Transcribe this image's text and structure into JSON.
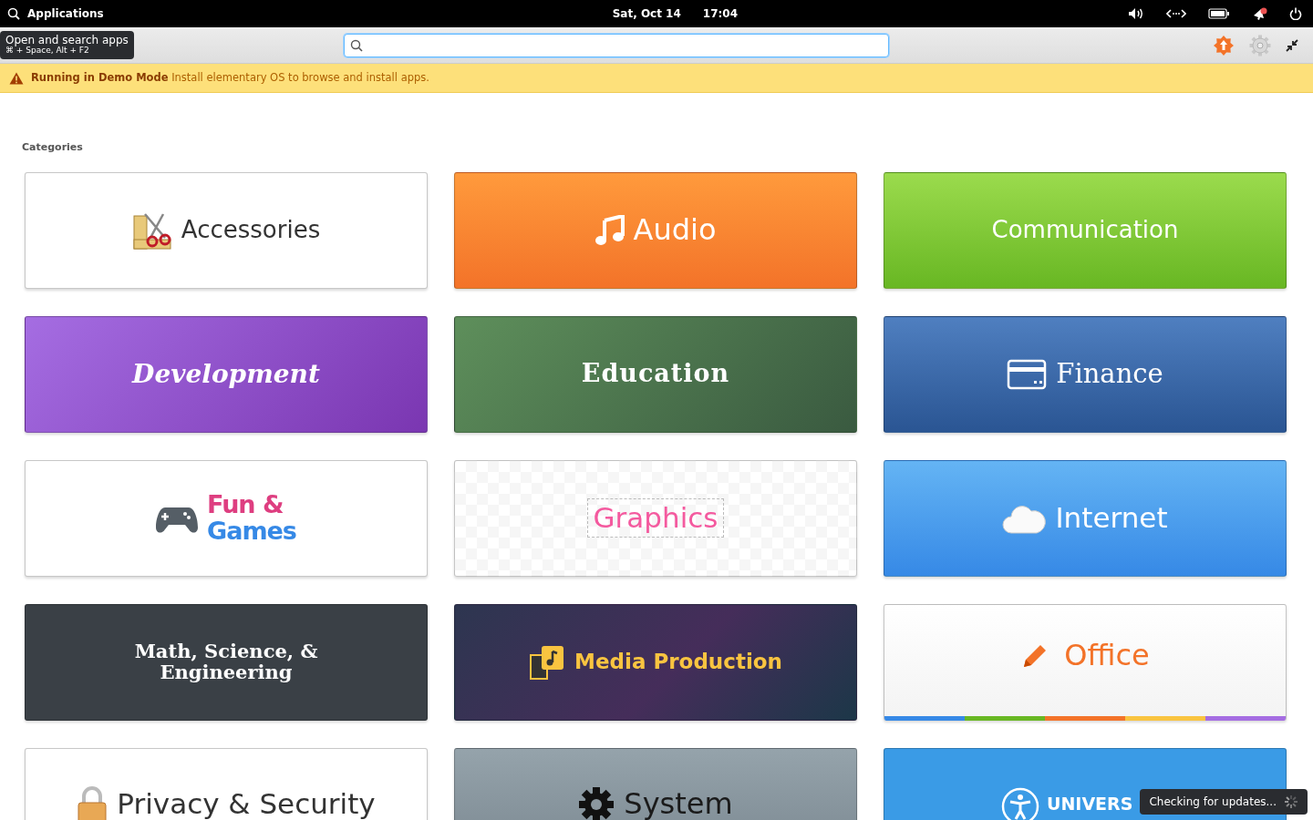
{
  "top_panel": {
    "applications": "Applications",
    "date": "Sat, Oct 14",
    "time": "17:04",
    "notification_unread": true
  },
  "tooltip": {
    "title": "Open and search apps",
    "shortcut": "⌘ + Space, Alt + F2"
  },
  "banner": {
    "text": "**Running in Demo Mode** Install elementary OS to browse and install apps."
  },
  "section_title": "Categories",
  "categories": [
    {
      "kind": "accessories",
      "lines": [
        "Accessories"
      ]
    },
    {
      "kind": "audio",
      "lines": [
        "Audio"
      ]
    },
    {
      "kind": "communication",
      "lines": [
        "Communication"
      ]
    },
    {
      "kind": "development",
      "lines": [
        "Development"
      ]
    },
    {
      "kind": "education",
      "lines": [
        "Education"
      ]
    },
    {
      "kind": "finance",
      "lines": [
        "Finance"
      ]
    },
    {
      "kind": "games",
      "lines": [
        "Fun &",
        "Games"
      ]
    },
    {
      "kind": "graphics",
      "lines": [
        "Graphics"
      ]
    },
    {
      "kind": "internet",
      "lines": [
        "Internet"
      ]
    },
    {
      "kind": "science",
      "lines": [
        "Math, Science, &",
        "Engineering"
      ]
    },
    {
      "kind": "media",
      "lines": [
        "Media Production"
      ]
    },
    {
      "kind": "office",
      "lines": [
        "Office"
      ]
    },
    {
      "kind": "privacy",
      "lines": [
        "Privacy & Security"
      ]
    },
    {
      "kind": "system",
      "lines": [
        "System"
      ]
    },
    {
      "kind": "universal",
      "lines": [
        "UNIVERS"
      ]
    }
  ],
  "toast": {
    "text": "Checking for updates..."
  }
}
